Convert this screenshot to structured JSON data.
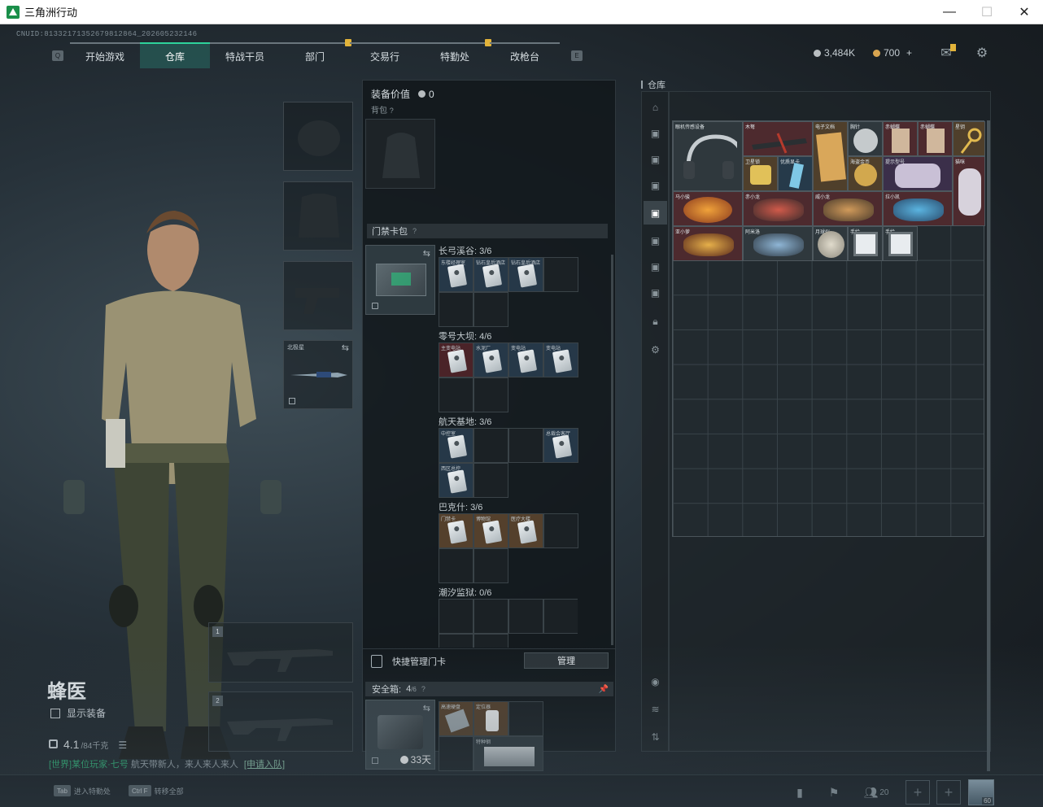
{
  "window": {
    "title": "三角洲行动",
    "minimize": "—",
    "maximize": "☐",
    "close": "✕"
  },
  "uid": "CNUID:8133217135267981286​4_202605232146",
  "nav": {
    "left_key": "Q",
    "right_key": "E",
    "tabs": [
      {
        "label": "开始游戏",
        "badge": false
      },
      {
        "label": "仓库",
        "badge": false,
        "active": true
      },
      {
        "label": "特战干员",
        "badge": false
      },
      {
        "label": "部门",
        "badge": true
      },
      {
        "label": "交易行",
        "badge": false
      },
      {
        "label": "特勤处",
        "badge": true
      },
      {
        "label": "改枪台",
        "badge": false
      }
    ]
  },
  "currency": {
    "havoc": "3,484K",
    "coupon": "700",
    "plus": "+"
  },
  "operator": {
    "name": "蜂医",
    "show_equipment": "显示装备",
    "weight": "4.1",
    "weight_cap": "/84千克"
  },
  "chat": {
    "prefix": "[世界]",
    "user": "某位玩家·七号",
    "message": "航天带新人，来人来人来人",
    "link": "[申请入队]"
  },
  "equipment": {
    "melee_label": "北极星",
    "weapon_slot_1": "1",
    "weapon_slot_2": "2"
  },
  "mid": {
    "equip_value_label": "装备价值",
    "equip_value": "0",
    "backpack_label": "背包",
    "keycard_pack_label": "门禁卡包",
    "groups": [
      {
        "title": "长弓溪谷: 3/6",
        "cards": [
          "东楼经理室",
          "钻石皇后酒店",
          "钻石皇后酒店"
        ]
      },
      {
        "title": "零号大坝: 4/6",
        "cards": [
          "主变电站",
          "水泥厂",
          "变电站",
          "变电站"
        ]
      },
      {
        "title": "航天基地: 3/6",
        "cards": [
          "中控室",
          "总裁会客厅",
          "西区总控"
        ]
      },
      {
        "title": "巴克什: 3/6",
        "cards": [
          "门禁卡",
          "博物馆",
          "医疗大楼"
        ]
      },
      {
        "title": "潮汐监狱: 0/6",
        "cards": []
      }
    ],
    "quick_manage_label": "快捷管理门卡",
    "manage_button": "管理",
    "safe_label": "安全箱:",
    "safe_count": "4",
    "safe_capacity": "/6",
    "safe_days": "33天",
    "safe_items": [
      "高速硬盘",
      "定位器",
      "特种钢"
    ]
  },
  "warehouse": {
    "title": "仓库",
    "items": [
      "眼机传感设备",
      "木弩",
      "电子文档",
      "胸针",
      "赤蝴蝶",
      "赤蝴蝶",
      "星钥",
      "卫星锁",
      "优质显卡",
      "海盗金币",
      "提示型号",
      "猫咪",
      "马小骏",
      "赤小龙",
      "威小龙",
      "拉小凯",
      "亚小萝",
      "阿米洛",
      "月球仪",
      "手绘",
      "手绘"
    ]
  },
  "bottom": {
    "hint1_key": "Tab",
    "hint1": "进入特勤处",
    "hint2_key": "Ctrl  F",
    "hint2": "转移全部",
    "friends": "20",
    "plus": "+",
    "level": "60"
  },
  "colors": {
    "accent": "#2ed39b",
    "badge": "#e2b33a"
  }
}
